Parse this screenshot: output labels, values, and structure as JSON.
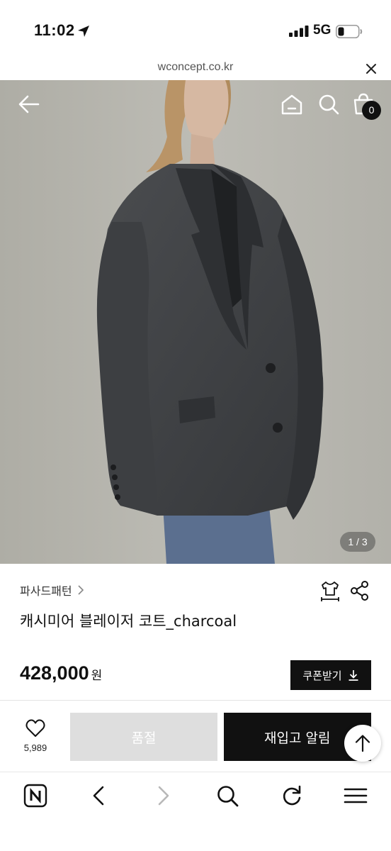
{
  "status_bar": {
    "time": "11:02",
    "network": "5G"
  },
  "browser": {
    "url": "wconcept.co.kr"
  },
  "hero": {
    "image_counter": "1 / 3",
    "cart_count": "0"
  },
  "product": {
    "brand": "파사드패턴",
    "name": "캐시미어 블레이저 코트_charcoal",
    "price": "428,000",
    "currency": "원",
    "coupon_label": "쿠폰받기"
  },
  "purchase_bar": {
    "like_count": "5,989",
    "soldout_label": "품절",
    "notify_label": "재입고 알림"
  },
  "icons": {
    "back": "arrow-left-icon",
    "home": "home-icon",
    "search": "search-icon",
    "cart": "shopping-bag-icon",
    "size": "size-guide-icon",
    "share": "share-icon",
    "like": "heart-icon",
    "scroll_top": "arrow-up-icon"
  },
  "colors": {
    "primary": "#111111",
    "soldout": "#dedede",
    "background": "#ffffff"
  }
}
